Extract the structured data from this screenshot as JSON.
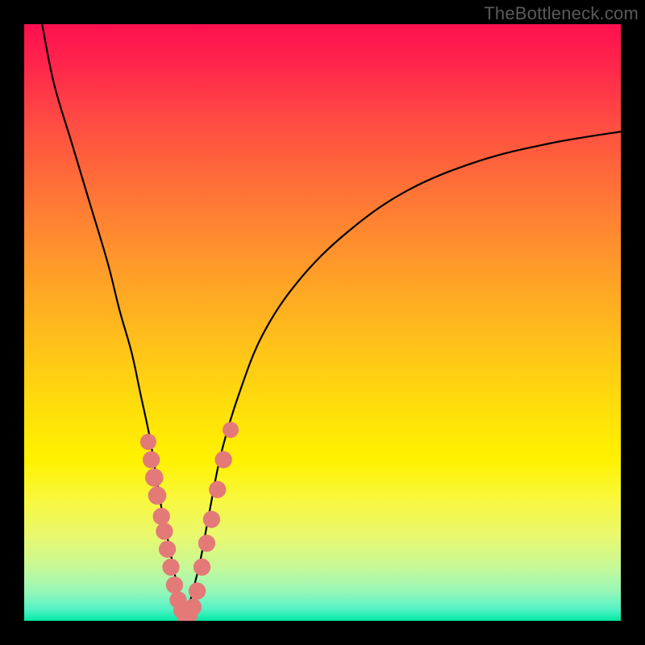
{
  "watermark": "TheBottleneck.com",
  "chart_data": {
    "type": "line",
    "title": "",
    "xlabel": "",
    "ylabel": "",
    "xlim": [
      0,
      100
    ],
    "ylim": [
      0,
      100
    ],
    "series": [
      {
        "name": "left-branch",
        "x": [
          3,
          5,
          8,
          11,
          14,
          16,
          18,
          19.5,
          21,
          22,
          23,
          24,
          24.8,
          25.4,
          26,
          26.5,
          27
        ],
        "y": [
          100,
          90,
          80,
          70,
          60,
          52,
          45,
          38,
          31,
          25,
          19,
          14,
          10,
          7,
          4,
          2,
          0.5
        ]
      },
      {
        "name": "right-branch",
        "x": [
          27,
          28,
          29.5,
          31,
          33,
          36,
          40,
          46,
          54,
          64,
          76,
          88,
          100
        ],
        "y": [
          0.5,
          4,
          10,
          18,
          28,
          38,
          48,
          57,
          65,
          72,
          77,
          80,
          82
        ]
      }
    ],
    "markers": [
      {
        "x": 20.8,
        "y": 30,
        "r": 0.9
      },
      {
        "x": 21.3,
        "y": 27,
        "r": 1.0
      },
      {
        "x": 21.8,
        "y": 24,
        "r": 1.1
      },
      {
        "x": 22.3,
        "y": 21,
        "r": 1.1
      },
      {
        "x": 23.0,
        "y": 17.5,
        "r": 1.0
      },
      {
        "x": 23.5,
        "y": 15,
        "r": 1.0
      },
      {
        "x": 24.0,
        "y": 12,
        "r": 1.0
      },
      {
        "x": 24.6,
        "y": 9,
        "r": 1.0
      },
      {
        "x": 25.2,
        "y": 6,
        "r": 1.0
      },
      {
        "x": 25.8,
        "y": 3.5,
        "r": 1.0
      },
      {
        "x": 26.4,
        "y": 1.8,
        "r": 1.0
      },
      {
        "x": 27.0,
        "y": 0.9,
        "r": 1.0
      },
      {
        "x": 27.6,
        "y": 0.9,
        "r": 1.0
      },
      {
        "x": 28.3,
        "y": 2.3,
        "r": 1.0
      },
      {
        "x": 29.0,
        "y": 5,
        "r": 1.0
      },
      {
        "x": 29.8,
        "y": 9,
        "r": 1.0
      },
      {
        "x": 30.6,
        "y": 13,
        "r": 1.0
      },
      {
        "x": 31.4,
        "y": 17,
        "r": 1.0
      },
      {
        "x": 32.4,
        "y": 22,
        "r": 1.0
      },
      {
        "x": 33.4,
        "y": 27,
        "r": 1.0
      },
      {
        "x": 34.6,
        "y": 32,
        "r": 0.9
      }
    ],
    "colors": {
      "curve": "#000000",
      "marker": "#e37a78"
    }
  }
}
